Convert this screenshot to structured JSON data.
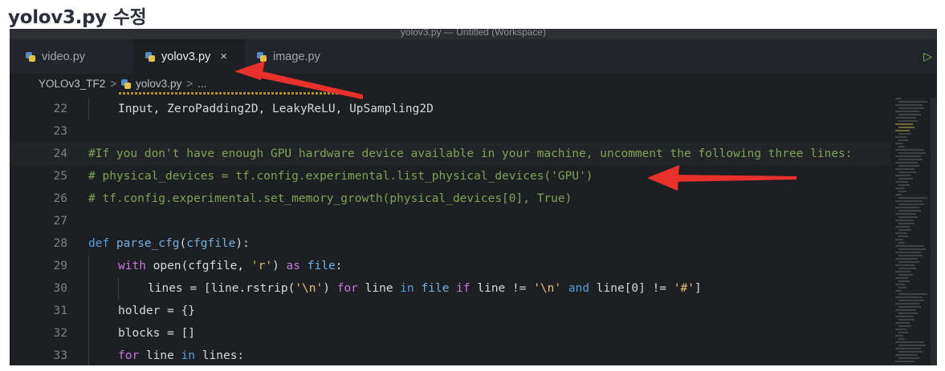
{
  "heading": "yolov3.py 수정",
  "window_title": "yolov3.py — Untitled (Workspace)",
  "tabs": [
    {
      "label": "video.py",
      "active": false
    },
    {
      "label": "yolov3.py",
      "active": true,
      "close": "×"
    },
    {
      "label": "image.py",
      "active": false
    }
  ],
  "breadcrumb": {
    "folder": "YOLOv3_TF2",
    "sep": ">",
    "file": "yolov3.py",
    "tail": "..."
  },
  "colors": {
    "arrow": "#e8312a",
    "comment": "#7ea25a",
    "keyword": "#c678dd",
    "string": "#e5c07b"
  },
  "icons": {
    "file": "python-file-icon",
    "run": "run-play-icon",
    "close": "close-icon"
  },
  "code": [
    {
      "n": "22",
      "indent": 1,
      "parts": [
        {
          "t": "Input, ZeroPadding2D, LeakyReLU, UpSampling2D"
        }
      ]
    },
    {
      "n": "23",
      "indent": 0,
      "parts": []
    },
    {
      "n": "24",
      "indent": 0,
      "parts": [
        {
          "c": "cmt",
          "t": "#If you don't have enough GPU hardware device available in your machine, uncomment the following three lines:"
        }
      ]
    },
    {
      "n": "25",
      "indent": 0,
      "parts": [
        {
          "c": "cmt",
          "t": "# physical_devices = tf.config.experimental.list_physical_devices('GPU')"
        }
      ]
    },
    {
      "n": "26",
      "indent": 0,
      "parts": [
        {
          "c": "cmt",
          "t": "# tf.config.experimental.set_memory_growth(physical_devices[0], True)"
        }
      ]
    },
    {
      "n": "27",
      "indent": 0,
      "parts": []
    },
    {
      "n": "28",
      "indent": 0,
      "parts": [
        {
          "c": "kw2",
          "t": "def "
        },
        {
          "c": "fn",
          "t": "parse_cfg"
        },
        {
          "t": "("
        },
        {
          "c": "fn",
          "t": "cfgfile"
        },
        {
          "t": "):"
        }
      ]
    },
    {
      "n": "29",
      "indent": 1,
      "parts": [
        {
          "c": "kw",
          "t": "with "
        },
        {
          "t": "open(cfgfile, "
        },
        {
          "c": "str",
          "t": "'r'"
        },
        {
          "t": ") "
        },
        {
          "c": "kw",
          "t": "as "
        },
        {
          "c": "fn",
          "t": "file"
        },
        {
          "t": ":"
        }
      ]
    },
    {
      "n": "30",
      "indent": 2,
      "parts": [
        {
          "t": "lines = [line.rstrip("
        },
        {
          "c": "str",
          "t": "'\\n'"
        },
        {
          "t": ") "
        },
        {
          "c": "kw",
          "t": "for "
        },
        {
          "t": "line "
        },
        {
          "c": "kw2",
          "t": "in "
        },
        {
          "c": "fn",
          "t": "file "
        },
        {
          "c": "kw",
          "t": "if "
        },
        {
          "t": "line != "
        },
        {
          "c": "str",
          "t": "'\\n'"
        },
        {
          "c": "kw2",
          "t": " and "
        },
        {
          "t": "line[0] != "
        },
        {
          "c": "str",
          "t": "'#'"
        },
        {
          "t": "]"
        }
      ]
    },
    {
      "n": "31",
      "indent": 1,
      "parts": [
        {
          "t": "holder = {}"
        }
      ]
    },
    {
      "n": "32",
      "indent": 1,
      "parts": [
        {
          "t": "blocks = []"
        }
      ]
    },
    {
      "n": "33",
      "indent": 1,
      "parts": [
        {
          "c": "kw",
          "t": "for "
        },
        {
          "t": "line "
        },
        {
          "c": "kw2",
          "t": "in "
        },
        {
          "t": "lines:"
        }
      ]
    }
  ]
}
